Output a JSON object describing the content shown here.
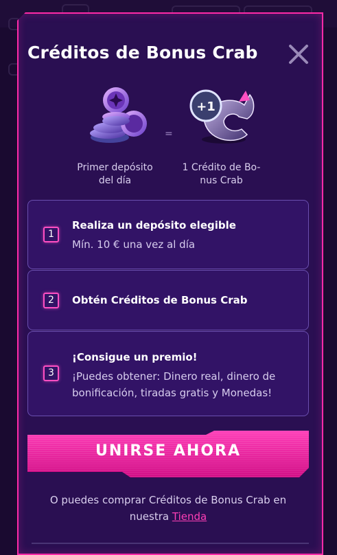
{
  "modal": {
    "title": "Créditos de Bonus Crab",
    "left_caption_line1": "Primer depósito",
    "left_caption_line2": "del día",
    "equals": "=",
    "right_caption_line1": "1 Crédito de Bo-",
    "right_caption_line2": "nus Crab",
    "badge_text": "+1",
    "steps": [
      {
        "number": "1",
        "title": "Realiza un depósito elegible",
        "subtitle": "Mín. 10 € una vez al día"
      },
      {
        "number": "2",
        "title": "Obtén Créditos de Bonus Crab"
      },
      {
        "number": "3",
        "title": "¡Consigue un premio!",
        "subtitle_line1": "¡Puedes obtener: Dinero real, dinero de",
        "subtitle_line2": "bonificación, tiradas gratis y Monedas!"
      }
    ],
    "cta_label": "UNIRSE AHORA",
    "footer_line1": "O puedes comprar Créditos de Bonus Crab en",
    "footer_prefix": "nuestra ",
    "footer_link": "Tienda"
  },
  "colors": {
    "accent": "#ff2aa8",
    "panel": "#2a0f52",
    "step_bg": "#321366",
    "step_border": "#6b4fb0"
  },
  "icons": [
    "close-icon",
    "coins-icon",
    "bonus-crab-credit-icon"
  ]
}
